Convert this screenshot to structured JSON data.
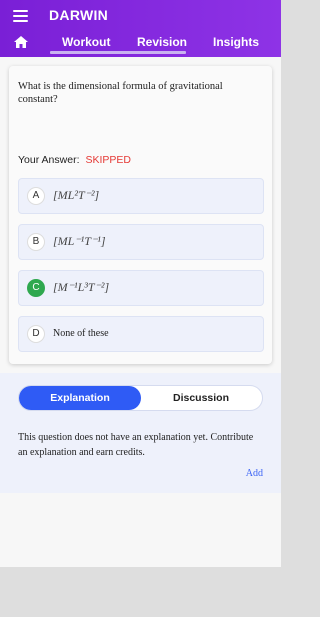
{
  "header": {
    "app_title": "DARWIN",
    "tabs": [
      "Workout",
      "Revision",
      "Insights"
    ]
  },
  "question": {
    "text": "What is the dimensional formula of gravitational constant?",
    "answer_label": "Your Answer:",
    "answer_value": "SKIPPED"
  },
  "options": [
    {
      "letter": "A",
      "text": "[ML²T⁻²]",
      "correct": false
    },
    {
      "letter": "B",
      "text": "[ML⁻¹T⁻¹]",
      "correct": false
    },
    {
      "letter": "C",
      "text": "[M⁻¹L³T⁻²]",
      "correct": true
    },
    {
      "letter": "D",
      "text": "None of these",
      "correct": false
    }
  ],
  "explanation": {
    "tabs": [
      "Explanation",
      "Discussion"
    ],
    "text": "This question does not have an explanation yet. Contribute an explanation and earn credits.",
    "add_label": "Add"
  },
  "colors": {
    "header": "#8e33e6",
    "accent": "#2f5bf5",
    "correct": "#2fa84f",
    "skipped": "#e53935"
  }
}
